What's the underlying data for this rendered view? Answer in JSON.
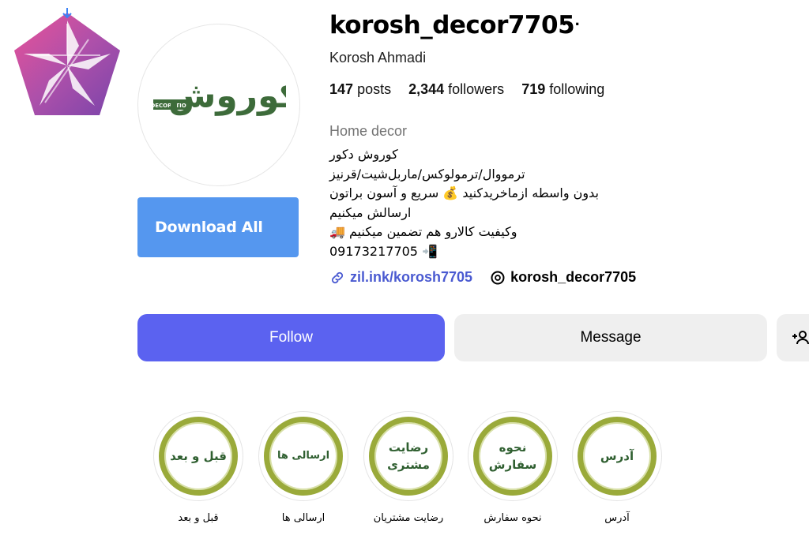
{
  "profile": {
    "username": "korosh_decor7705",
    "more_icon": "ellipsis-icon",
    "full_name": "Korosh Ahmadi",
    "stats": [
      {
        "count": "147",
        "label": "posts"
      },
      {
        "count": "2,344",
        "label": "followers"
      },
      {
        "count": "719",
        "label": "following"
      }
    ],
    "category": "Home decor",
    "bio_lines": [
      "کوروش دکور",
      "ترمووال/ترمولوکس/ماربل‌شیت/قرنیز",
      "بدون واسطه ازماخریدکنید 💰 سریع و آسون براتون",
      "ارسالش میکنیم",
      "وکیفیت کالارو هم تضمین میکنیم 🚚",
      "09173217705 📲"
    ],
    "external_link": "zil.ink/korosh7705",
    "threads_handle": "korosh_decor7705",
    "avatar_text": "کوروش",
    "avatar_subtext": "DECORATION"
  },
  "actions": {
    "download_all": "Download All",
    "follow": "Follow",
    "message": "Message"
  },
  "highlights": [
    {
      "title": "آدرس",
      "label": "آدرس"
    },
    {
      "title": "نحوه سفارش",
      "label": "نحوه سفارش"
    },
    {
      "title": "رضایت مشتری",
      "label": "رضایت مشتریان"
    },
    {
      "title": "ارسالی ها",
      "label": "ارسالی ها"
    },
    {
      "title": "قبل و بعد",
      "label": "قبل و بعد"
    }
  ],
  "colors": {
    "follow": "#5b62f0",
    "download": "#5597ef",
    "link": "#4a5ad1",
    "brand_green": "#3d6b3a"
  }
}
